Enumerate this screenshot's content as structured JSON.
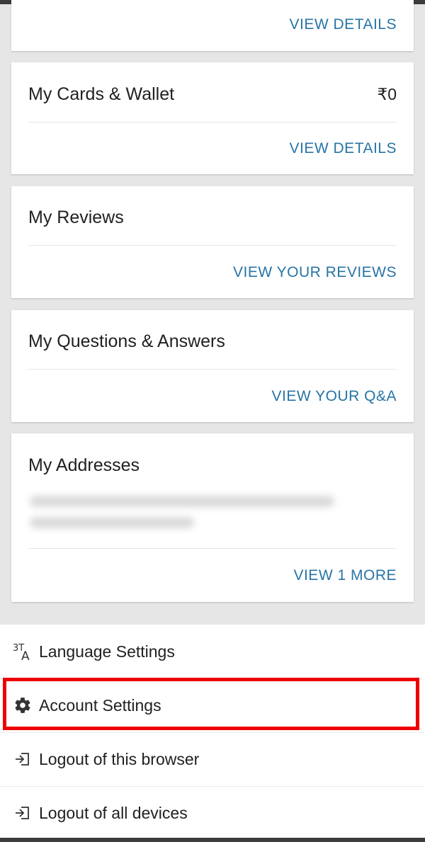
{
  "cards": {
    "top_partial": {
      "link": "VIEW DETAILS"
    },
    "cards_wallet": {
      "title": "My Cards & Wallet",
      "value": "₹0",
      "link": "VIEW DETAILS"
    },
    "reviews": {
      "title": "My Reviews",
      "link": "VIEW YOUR REVIEWS"
    },
    "qna": {
      "title": "My Questions & Answers",
      "link": "VIEW YOUR Q&A"
    },
    "addresses": {
      "title": "My Addresses",
      "link": "VIEW 1 MORE"
    }
  },
  "menu": {
    "items": [
      {
        "label": "Language Settings",
        "icon": "language-icon"
      },
      {
        "label": "Account Settings",
        "icon": "gear-icon"
      },
      {
        "label": "Logout of this browser",
        "icon": "logout-icon"
      },
      {
        "label": "Logout of all devices",
        "icon": "logout-icon"
      }
    ]
  },
  "colors": {
    "link": "#2874a6",
    "background": "#e6e6e6",
    "highlight": "#ee0000"
  }
}
